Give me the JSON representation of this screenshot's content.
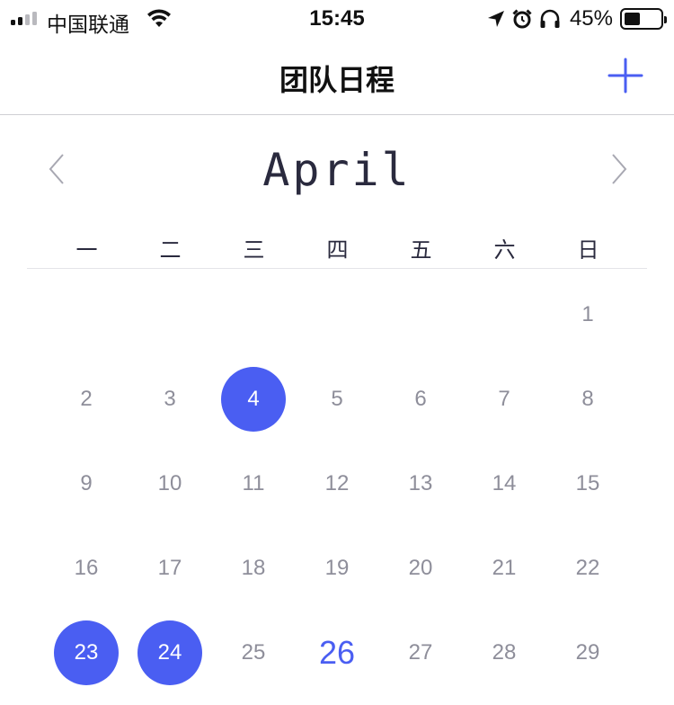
{
  "status_bar": {
    "carrier": "中国联通",
    "time": "15:45",
    "battery_percent": "45%",
    "battery_level": 0.45,
    "icons": [
      "signal-icon",
      "wifi-icon",
      "location-arrow-icon",
      "alarm-icon",
      "headphones-icon",
      "battery-icon"
    ]
  },
  "nav": {
    "title": "团队日程",
    "add_icon": "plus-icon"
  },
  "calendar": {
    "month": "April",
    "weekdays": [
      "一",
      "二",
      "三",
      "四",
      "五",
      "六",
      "日"
    ],
    "days": [
      "1",
      "2",
      "3",
      "4",
      "5",
      "6",
      "7",
      "8",
      "9",
      "10",
      "11",
      "12",
      "13",
      "14",
      "15",
      "16",
      "17",
      "18",
      "19",
      "20",
      "21",
      "22",
      "23",
      "24",
      "25",
      "26",
      "27",
      "28",
      "29"
    ],
    "first_day_weekday_index": 6,
    "selected_days": [
      "4",
      "23",
      "24"
    ],
    "today": "26"
  },
  "colors": {
    "accent": "#4a5ef2",
    "day_text": "#8e8e9a",
    "title_text": "#2a2a3e"
  }
}
